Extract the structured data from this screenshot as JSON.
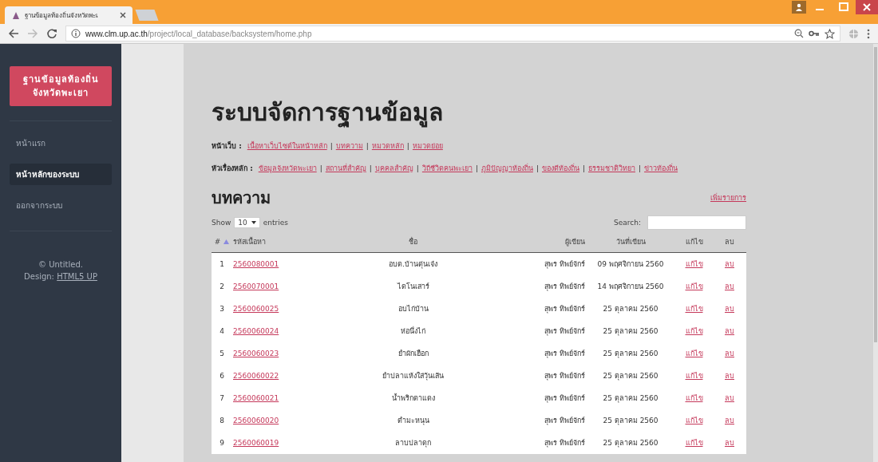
{
  "browser": {
    "tab_title": "ฐานข้อมูลท้องถิ่นจังหวัดพะเ",
    "url_host": "www.clm.up.ac.th",
    "url_path": "/project/local_database/backsystem/home.php"
  },
  "sidebar": {
    "logo": [
      "ฐานข้อมูลท้องถิ่น",
      "จังหวัดพะเยา"
    ],
    "items": [
      {
        "label": "หน้าแรก",
        "selected": false
      },
      {
        "label": "หน้าหลักของระบบ",
        "selected": true
      },
      {
        "label": "ออกจากระบบ",
        "selected": false
      }
    ],
    "footer": {
      "copyright": "© Untitled.",
      "design_label": "Design:",
      "design_link": "HTML5 UP"
    }
  },
  "page_title": "ระบบจัดการฐานข้อมูล",
  "nav": [
    {
      "label": "หน้าเว็บ :",
      "links": [
        "เนื้อหาเว็บไซต์ในหน้าหลัก",
        "บทความ",
        "หมวดหลัก",
        "หมวดย่อย"
      ]
    },
    {
      "label": "หัวเรื่องหลัก :",
      "links": [
        "ข้อมูลจังหวัดพะเยา",
        "สถานที่สำคัญ",
        "บุคคลสำคัญ",
        "วิถีชีวิตคนพะเยา",
        "ภูมิปัญญาท้องถิ่น",
        "ของดีท้องถิ่น",
        "ธรรมชาติวิทยา",
        "ข่าวท้องถิ่น"
      ]
    }
  ],
  "nav_separator": "|",
  "section": {
    "title": "บทความ",
    "add_link": "เพิ่มรายการ"
  },
  "table": {
    "show_label": "Show",
    "page_size": "10",
    "entries_label": "entries",
    "search_label": "Search:",
    "columns": [
      "#",
      "รหัสเนื้อหา",
      "ชื่อ",
      "ผู้เขียน",
      "วันที่เขียน",
      "แก้ไข",
      "ลบ"
    ],
    "rows": [
      [
        "1",
        "2560080001",
        "อบต.บ้านตุ่นเจ๋ง",
        "สุพร ทิพย์จักร์",
        "09 พฤศจิกายน 2560",
        "แก้ไข",
        "ลบ"
      ],
      [
        "2",
        "2560070001",
        "ไดโนเสาร์",
        "สุพร ทิพย์จักร์",
        "14 พฤศจิกายน 2560",
        "แก้ไข",
        "ลบ"
      ],
      [
        "3",
        "2560060025",
        "อบไก่บ้าน",
        "สุพร ทิพย์จักร์",
        "25 ตุลาคม 2560",
        "แก้ไข",
        "ลบ"
      ],
      [
        "4",
        "2560060024",
        "ห่อนึ่งไก่",
        "สุพร ทิพย์จักร์",
        "25 ตุลาคม 2560",
        "แก้ไข",
        "ลบ"
      ],
      [
        "5",
        "2560060023",
        "ยำผักเฮือก",
        "สุพร ทิพย์จักร์",
        "25 ตุลาคม 2560",
        "แก้ไข",
        "ลบ"
      ],
      [
        "6",
        "2560060022",
        "ยำปลาแห้งใส่วุ้นเส้น",
        "สุพร ทิพย์จักร์",
        "25 ตุลาคม 2560",
        "แก้ไข",
        "ลบ"
      ],
      [
        "7",
        "2560060021",
        "น้ำพริกตาแดง",
        "สุพร ทิพย์จักร์",
        "25 ตุลาคม 2560",
        "แก้ไข",
        "ลบ"
      ],
      [
        "8",
        "2560060020",
        "ตำมะหนุน",
        "สุพร ทิพย์จักร์",
        "25 ตุลาคม 2560",
        "แก้ไข",
        "ลบ"
      ],
      [
        "9",
        "2560060019",
        "ลาบปลาดุก",
        "สุพร ทิพย์จักร์",
        "25 ตุลาคม 2560",
        "แก้ไข",
        "ลบ"
      ]
    ]
  }
}
